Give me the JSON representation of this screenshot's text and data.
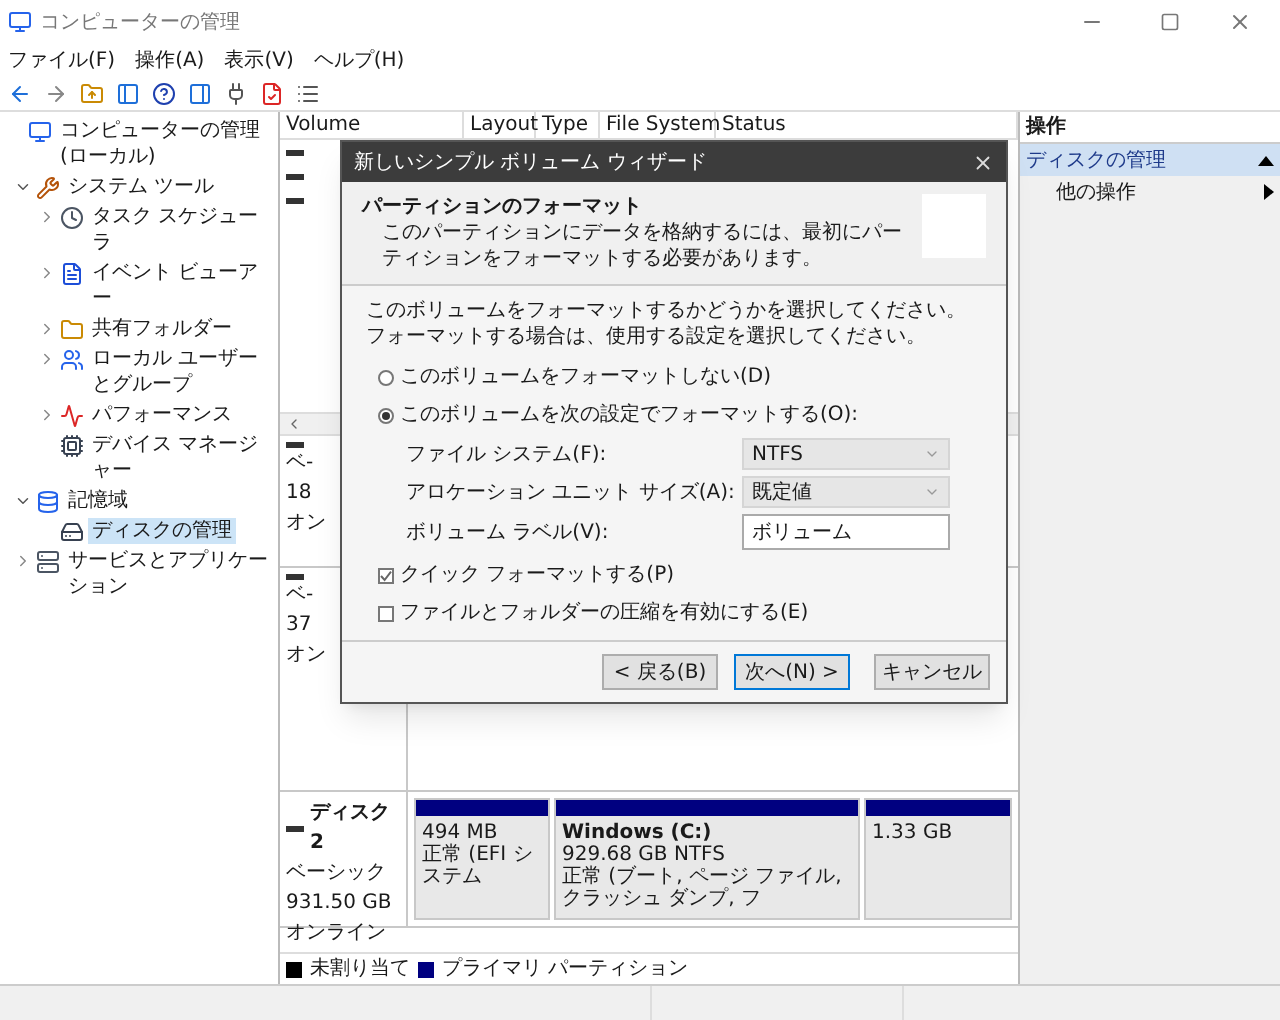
{
  "window": {
    "title": "コンピューターの管理"
  },
  "menu": [
    "ファイル(F)",
    "操作(A)",
    "表示(V)",
    "ヘルプ(H)"
  ],
  "tree": [
    {
      "label": "コンピューターの管理 (ローカル)",
      "kind": "computer",
      "selected": false,
      "children": [
        {
          "label": "システム ツール",
          "kind": "tools",
          "expanded": true,
          "selected": false,
          "children": [
            {
              "label": "タスク スケジューラ",
              "kind": "clock",
              "expanded": false,
              "selected": false
            },
            {
              "label": "イベント ビューアー",
              "kind": "log",
              "expanded": false,
              "selected": false
            },
            {
              "label": "共有フォルダー",
              "kind": "folder",
              "expanded": false,
              "selected": false
            },
            {
              "label": "ローカル ユーザーとグループ",
              "kind": "users",
              "expanded": false,
              "selected": false
            },
            {
              "label": "パフォーマンス",
              "kind": "performance",
              "expanded": false,
              "selected": false
            },
            {
              "label": "デバイス マネージャー",
              "kind": "device",
              "selected": false
            }
          ]
        },
        {
          "label": "記憶域",
          "kind": "storage",
          "expanded": true,
          "selected": false,
          "children": [
            {
              "label": "ディスクの管理",
              "kind": "disk",
              "selected": true
            }
          ]
        },
        {
          "label": "サービスとアプリケーション",
          "kind": "services",
          "expanded": false,
          "selected": false
        }
      ]
    }
  ],
  "volume_list": {
    "columns": [
      "Volume",
      "Layout",
      "Type",
      "File System",
      "Status"
    ],
    "rows": [
      {
        "kind": "disk"
      },
      {
        "kind": "disk"
      },
      {
        "kind": "disk"
      }
    ]
  },
  "disks": [
    {
      "lines": [
        "ベ-",
        "18",
        "オン"
      ]
    },
    {
      "lines": [
        "ベ-",
        "37",
        "オン"
      ]
    },
    {
      "name": "ディスク 2",
      "lines": [
        "ベーシック",
        "931.50 GB",
        "オンライン"
      ],
      "partitions": [
        {
          "lines": [
            "494 MB",
            "正常 (EFI システム"
          ],
          "color": "#000080"
        },
        {
          "title": "Windows  (C:)",
          "lines": [
            "929.68 GB NTFS",
            "正常 (ブート, ページ ファイル, クラッシュ ダンプ, フ"
          ],
          "color": "#000080"
        },
        {
          "lines": [
            "1.33 GB"
          ],
          "color": "#000080"
        }
      ]
    }
  ],
  "legend": [
    {
      "label": "未割り当て",
      "color": "#000000"
    },
    {
      "label": "プライマリ パーティション",
      "color": "#000080"
    }
  ],
  "actions": {
    "header": "操作",
    "items": [
      {
        "label": "ディスクの管理",
        "kind": "section",
        "selected": true
      },
      {
        "label": "他の操作",
        "kind": "submenu",
        "selected": false
      }
    ]
  },
  "dialog": {
    "title": "新しいシンプル ボリューム ウィザード",
    "heading": "パーティションのフォーマット",
    "subheading": "このパーティションにデータを格納するには、最初にパーティションをフォーマットする必要があります。",
    "intro": "このボリュームをフォーマットするかどうかを選択してください。フォーマットする場合は、使用する設定を選択してください。",
    "options": [
      {
        "label": "このボリュームをフォーマットしない(D)",
        "selected": false
      },
      {
        "label": "このボリュームを次の設定でフォーマットする(O):",
        "selected": true
      }
    ],
    "fields": [
      {
        "kind": "dropdown",
        "label": "ファイル システム(F):",
        "value": "NTFS"
      },
      {
        "kind": "dropdown",
        "label": "アロケーション ユニット サイズ(A):",
        "value": "既定値"
      },
      {
        "kind": "text",
        "label": "ボリューム ラベル(V):",
        "value": "ボリューム"
      }
    ],
    "checkboxes": [
      {
        "label": "クイック フォーマットする(P)",
        "checked": true
      },
      {
        "label": "ファイルとフォルダーの圧縮を有効にする(E)",
        "checked": false
      }
    ],
    "buttons": [
      {
        "label": "< 戻る(B)",
        "default": false
      },
      {
        "label": "次へ(N) >",
        "default": true
      },
      {
        "label": "キャンセル",
        "default": false
      }
    ]
  }
}
